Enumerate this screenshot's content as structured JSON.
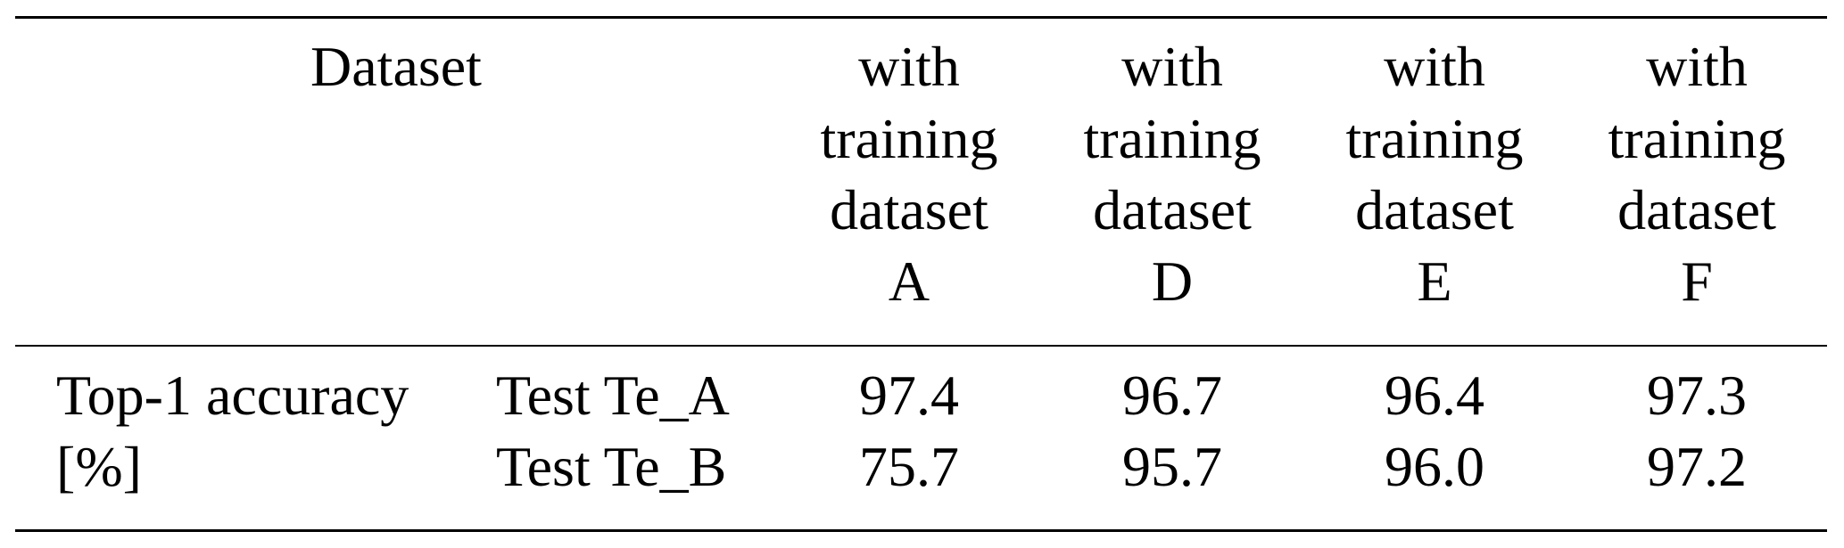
{
  "table": {
    "header": {
      "dataset_label": "Dataset",
      "columns": [
        {
          "lines": [
            "with",
            "training",
            "dataset",
            "A"
          ]
        },
        {
          "lines": [
            "with",
            "training",
            "dataset",
            "D"
          ]
        },
        {
          "lines": [
            "with",
            "training",
            "dataset",
            "E"
          ]
        },
        {
          "lines": [
            "with",
            "training",
            "dataset",
            "F"
          ]
        }
      ]
    },
    "row_group_label": [
      "Top-1 accuracy",
      "[%]"
    ],
    "rows": [
      {
        "label": "Test Te_A",
        "values": [
          "97.4",
          "96.7",
          "96.4",
          "97.3"
        ]
      },
      {
        "label": "Test Te_B",
        "values": [
          "75.7",
          "95.7",
          "96.0",
          "97.2"
        ]
      }
    ]
  }
}
